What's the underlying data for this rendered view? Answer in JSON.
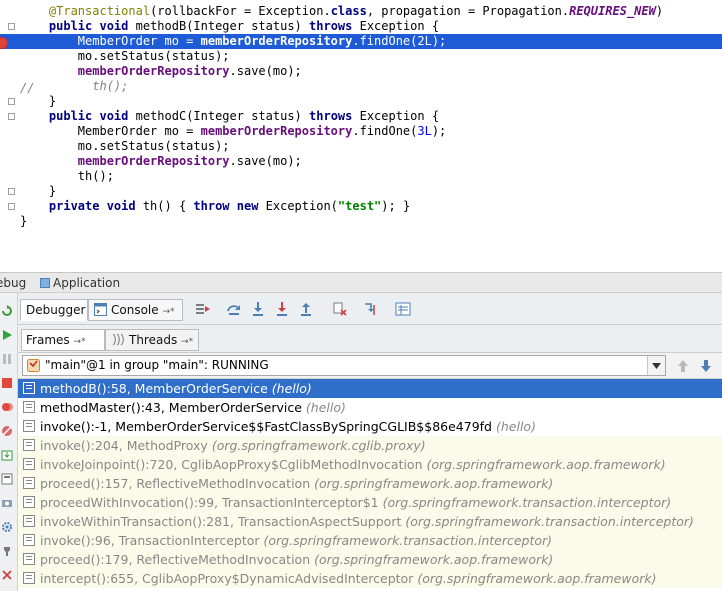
{
  "editor": {
    "lines": [
      {
        "segments": [
          {
            "t": "    "
          },
          {
            "t": "@Transactional",
            "c": "ann"
          },
          {
            "t": "(rollbackFor = Exception."
          },
          {
            "t": "class",
            "c": "kw"
          },
          {
            "t": ", propagation = Propagation."
          },
          {
            "t": "REQUIRES_NEW",
            "c": "sfld"
          },
          {
            "t": ")"
          }
        ]
      },
      {
        "segments": [
          {
            "t": "    "
          },
          {
            "t": "public void",
            "c": "kw"
          },
          {
            "t": " methodB(Integer status) "
          },
          {
            "t": "throws",
            "c": "kw"
          },
          {
            "t": " Exception {"
          }
        ]
      },
      {
        "segments": [
          {
            "t": "        MemberOrder mo = "
          },
          {
            "t": "memberOrderRepository",
            "c": "fld"
          },
          {
            "t": ".findOne("
          },
          {
            "t": "2L",
            "c": "num"
          },
          {
            "t": ");"
          }
        ]
      },
      {
        "segments": [
          {
            "t": "        mo.setStatus(status);"
          }
        ]
      },
      {
        "segments": [
          {
            "t": "        "
          },
          {
            "t": "memberOrderRepository",
            "c": "fld"
          },
          {
            "t": ".save(mo);"
          }
        ]
      },
      {
        "segments": [
          {
            "t": "          th();",
            "c": "cmt"
          }
        ]
      },
      {
        "segments": [
          {
            "t": "    }"
          }
        ]
      },
      {
        "segments": [
          {
            "t": "    "
          },
          {
            "t": "public void",
            "c": "kw"
          },
          {
            "t": " methodC(Integer status) "
          },
          {
            "t": "throws",
            "c": "kw"
          },
          {
            "t": " Exception {"
          }
        ]
      },
      {
        "segments": [
          {
            "t": "        MemberOrder mo = "
          },
          {
            "t": "memberOrderRepository",
            "c": "fld"
          },
          {
            "t": ".findOne("
          },
          {
            "t": "3L",
            "c": "num"
          },
          {
            "t": ");"
          }
        ]
      },
      {
        "segments": [
          {
            "t": "        mo.setStatus(status);"
          }
        ]
      },
      {
        "segments": [
          {
            "t": "        "
          },
          {
            "t": "memberOrderRepository",
            "c": "fld"
          },
          {
            "t": ".save(mo);"
          }
        ]
      },
      {
        "segments": [
          {
            "t": "        th();"
          }
        ]
      },
      {
        "segments": [
          {
            "t": "    }"
          }
        ]
      },
      {
        "segments": [
          {
            "t": "    "
          },
          {
            "t": "private void",
            "c": "kw"
          },
          {
            "t": " th() { "
          },
          {
            "t": "throw new",
            "c": "kw"
          },
          {
            "t": " Exception("
          },
          {
            "t": "\"test\"",
            "c": "str"
          },
          {
            "t": "); }"
          }
        ]
      },
      {
        "segments": [
          {
            "t": "}"
          }
        ]
      }
    ],
    "highlighted_line": 2,
    "line_comment": "//",
    "colors": {
      "highlight": "#1e5bd6",
      "keyword": "#000080",
      "annotation": "#808000",
      "field": "#660e7a",
      "number": "#0000ff",
      "string": "#008000"
    }
  },
  "debug": {
    "title_prefix": "ebug",
    "config_name": "Application",
    "tabs": [
      {
        "label": "Debugger",
        "active": true
      },
      {
        "label": "Console",
        "active": false
      }
    ],
    "toolbar_icons": [
      "show-execution-point-icon",
      "step-over-icon",
      "step-into-icon",
      "force-step-into-icon",
      "step-out-icon",
      "drop-frame-icon",
      "run-to-cursor-icon",
      "evaluate-expression-icon"
    ],
    "frame_tabs": [
      {
        "label": "Frames"
      },
      {
        "label": "Threads"
      }
    ],
    "tab_pin": "→*",
    "thread": "\"main\"@1 in group \"main\": RUNNING",
    "frames": [
      {
        "method": "methodB():58, MemberOrderService",
        "cls": "(hello)",
        "kind": "selected"
      },
      {
        "method": "methodMaster():43, MemberOrderService",
        "cls": "(hello)",
        "kind": "normal"
      },
      {
        "method": "invoke():-1, MemberOrderService$$FastClassBySpringCGLIB$$86e479fd",
        "cls": "(hello)",
        "kind": "normal"
      },
      {
        "method": "invoke():204, MethodProxy",
        "cls": "(org.springframework.cglib.proxy)",
        "kind": "lib"
      },
      {
        "method": "invokeJoinpoint():720, CglibAopProxy$CglibMethodInvocation",
        "cls": "(org.springframework.aop.framework)",
        "kind": "lib"
      },
      {
        "method": "proceed():157, ReflectiveMethodInvocation",
        "cls": "(org.springframework.aop.framework)",
        "kind": "lib"
      },
      {
        "method": "proceedWithInvocation():99, TransactionInterceptor$1",
        "cls": "(org.springframework.transaction.interceptor)",
        "kind": "lib"
      },
      {
        "method": "invokeWithinTransaction():281, TransactionAspectSupport",
        "cls": "(org.springframework.transaction.interceptor)",
        "kind": "lib"
      },
      {
        "method": "invoke():96, TransactionInterceptor",
        "cls": "(org.springframework.transaction.interceptor)",
        "kind": "lib"
      },
      {
        "method": "proceed():179, ReflectiveMethodInvocation",
        "cls": "(org.springframework.aop.framework)",
        "kind": "lib"
      },
      {
        "method": "intercept():655, CglibAopProxy$DynamicAdvisedInterceptor",
        "cls": "(org.springframework.aop.framework)",
        "kind": "lib"
      }
    ]
  }
}
